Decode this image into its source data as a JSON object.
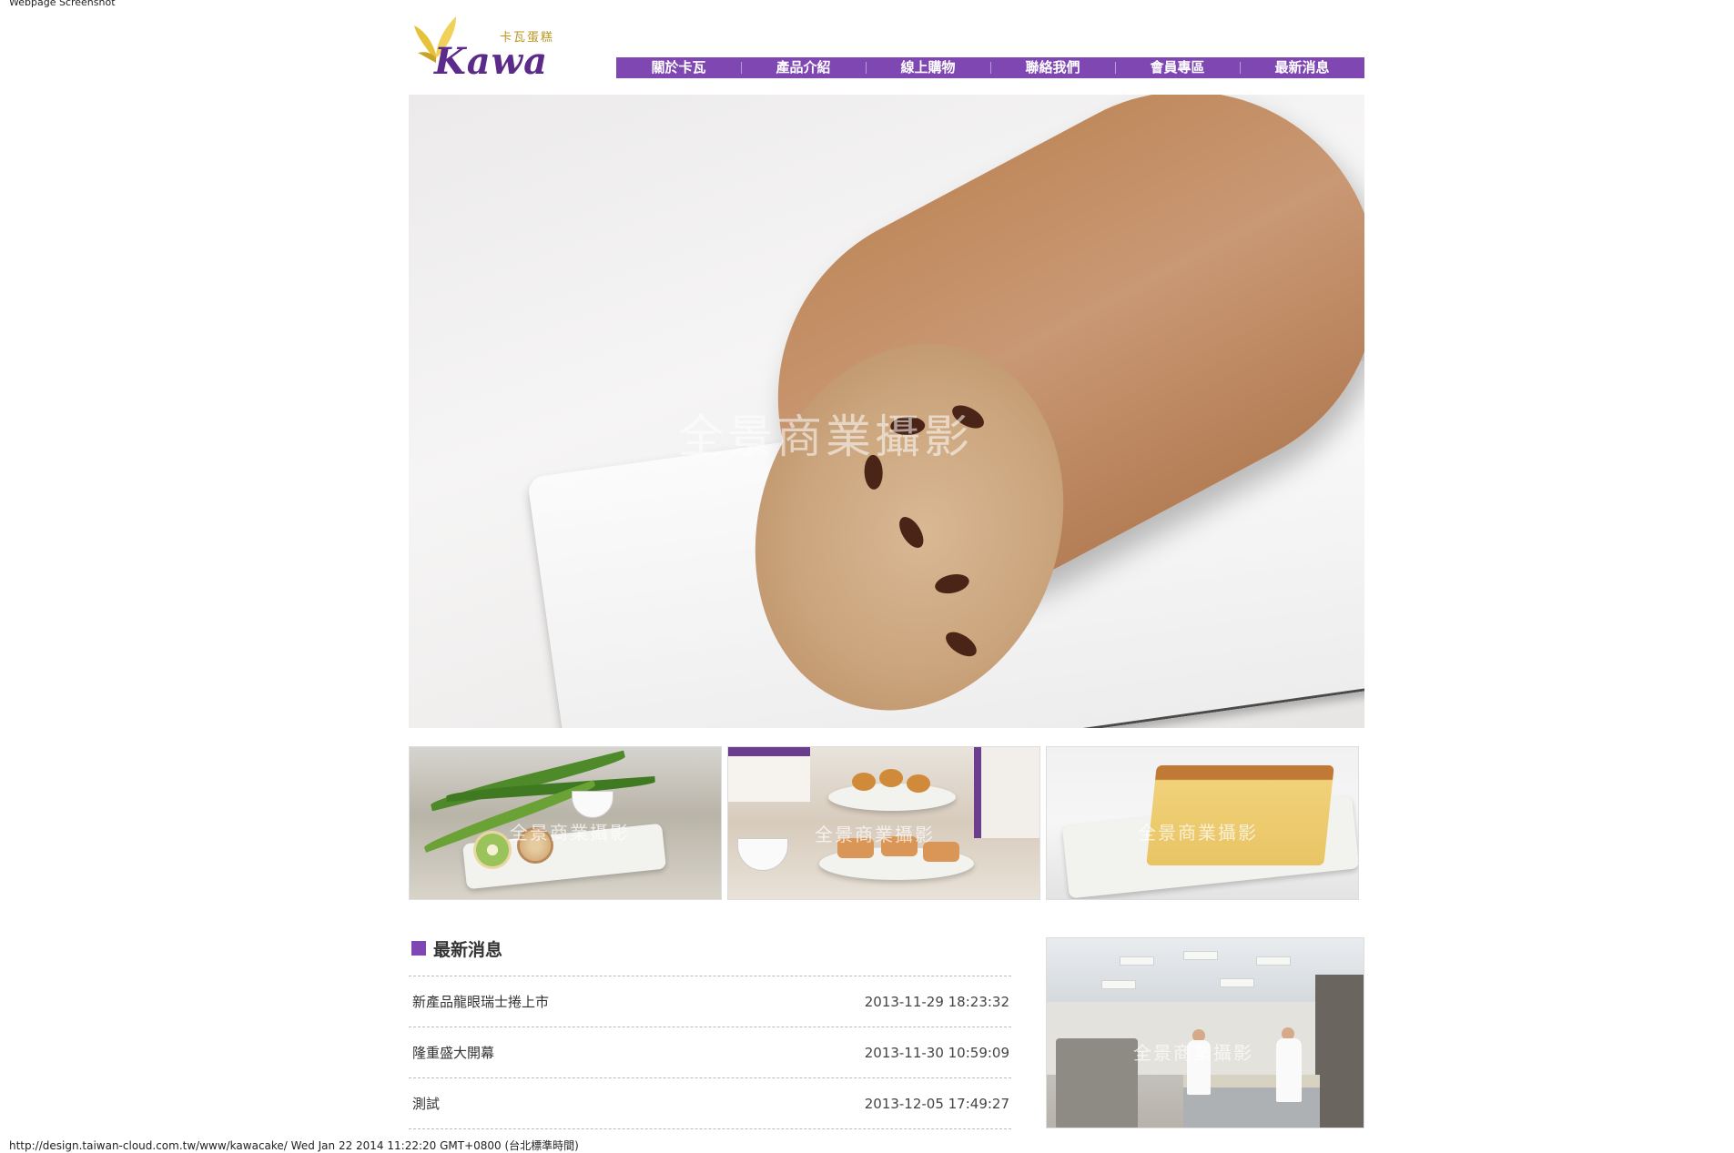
{
  "page": {
    "top_label": "Webpage Screenshot",
    "footer": "http://design.taiwan-cloud.com.tw/www/kawacake/ Wed Jan 22 2014 11:22:20 GMT+0800 (台北標準時間)"
  },
  "logo": {
    "name": "Kawa",
    "subtitle": "卡瓦蛋糕"
  },
  "nav": {
    "items": [
      "關於卡瓦",
      "產品介紹",
      "線上購物",
      "聯絡我們",
      "會員專區",
      "最新消息"
    ]
  },
  "hero": {
    "watermark": "全景商業攝影"
  },
  "thumbs": {
    "watermark": "全景商業攝影"
  },
  "news": {
    "title": "最新消息",
    "items": [
      {
        "title": "新產品龍眼瑞士捲上市",
        "date": "2013-11-29 18:23:32"
      },
      {
        "title": "隆重盛大開幕",
        "date": "2013-11-30 10:59:09"
      },
      {
        "title": "測試",
        "date": "2013-12-05 17:49:27"
      }
    ]
  },
  "kitchen": {
    "watermark": "全景商業攝影"
  },
  "colors": {
    "accent": "#7f47b2",
    "logo": "#5b2a8a",
    "logo_gold": "#b8941f"
  }
}
